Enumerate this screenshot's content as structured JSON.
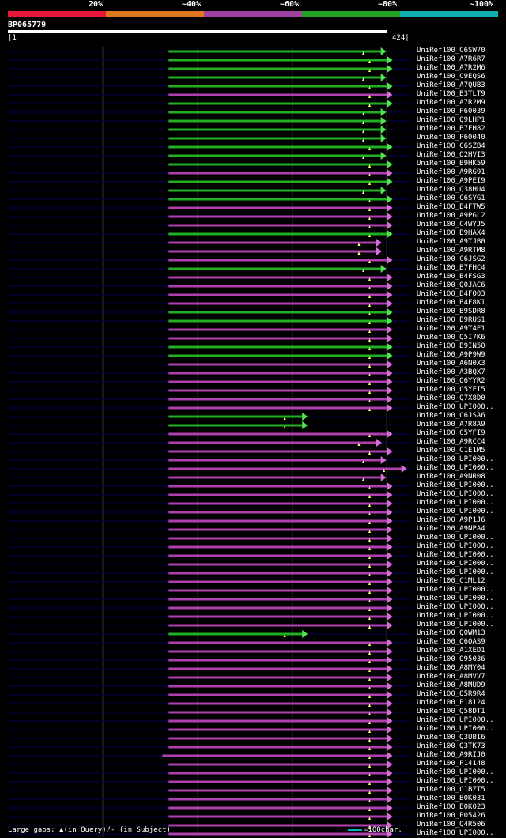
{
  "legend": {
    "colors": [
      "#e8173a",
      "#e07820",
      "#a040a0",
      "#22a022",
      "#10b0b0"
    ],
    "labels": [
      "20%",
      "~40%",
      "~60%",
      "~80%",
      "~100%"
    ]
  },
  "query": {
    "name": "BP065779",
    "start": "1",
    "end": "424"
  },
  "footer": {
    "gaps_text": "Large gaps: ▲(in Query)/- (in Subject)",
    "scale_text": "=100char."
  },
  "colors": {
    "green": "#22b022",
    "purple": "#b040b0",
    "green_head": "#55e055",
    "purple_head": "#d070d0",
    "query": "#ffffff",
    "grid": "#303030",
    "track": "#000055",
    "gap": "#ffff66"
  },
  "hits": [
    {
      "name": "UniRef100_C6SW70",
      "c": "g",
      "s": 180,
      "e": 421
    },
    {
      "name": "UniRef100_A7R6R7",
      "c": "g",
      "s": 180,
      "e": 428
    },
    {
      "name": "UniRef100_A7R2M6",
      "c": "g",
      "s": 180,
      "e": 428
    },
    {
      "name": "UniRef100_C9EQS6",
      "c": "g",
      "s": 180,
      "e": 421
    },
    {
      "name": "UniRef100_A7QUB3",
      "c": "g",
      "s": 180,
      "e": 428
    },
    {
      "name": "UniRef100_B3TLT9",
      "c": "p",
      "s": 180,
      "e": 428
    },
    {
      "name": "UniRef100_A7R2M9",
      "c": "g",
      "s": 180,
      "e": 428
    },
    {
      "name": "UniRef100_P60039",
      "c": "g",
      "s": 180,
      "e": 421
    },
    {
      "name": "UniRef100_Q9LHP1",
      "c": "g",
      "s": 180,
      "e": 421
    },
    {
      "name": "UniRef100_B7FH82",
      "c": "g",
      "s": 180,
      "e": 421
    },
    {
      "name": "UniRef100_P60040",
      "c": "g",
      "s": 180,
      "e": 421
    },
    {
      "name": "UniRef100_C6SZB4",
      "c": "g",
      "s": 180,
      "e": 428
    },
    {
      "name": "UniRef100_Q2HVI3",
      "c": "g",
      "s": 180,
      "e": 421
    },
    {
      "name": "UniRef100_B9HK59",
      "c": "g",
      "s": 180,
      "e": 428
    },
    {
      "name": "UniRef100_A9RG91",
      "c": "p",
      "s": 180,
      "e": 428
    },
    {
      "name": "UniRef100_A9PEI9",
      "c": "g",
      "s": 180,
      "e": 428
    },
    {
      "name": "UniRef100_Q38HU4",
      "c": "g",
      "s": 180,
      "e": 421
    },
    {
      "name": "UniRef100_C6SYG1",
      "c": "g",
      "s": 180,
      "e": 428
    },
    {
      "name": "UniRef100_B4FTW5",
      "c": "p",
      "s": 180,
      "e": 428
    },
    {
      "name": "UniRef100_A9PGL2",
      "c": "p",
      "s": 180,
      "e": 428
    },
    {
      "name": "UniRef100_C4WYJ5",
      "c": "p",
      "s": 180,
      "e": 428
    },
    {
      "name": "UniRef100_B9HAX4",
      "c": "g",
      "s": 180,
      "e": 428
    },
    {
      "name": "UniRef100_A9TJB0",
      "c": "p",
      "s": 180,
      "e": 416
    },
    {
      "name": "UniRef100_A9RTM8",
      "c": "p",
      "s": 180,
      "e": 416
    },
    {
      "name": "UniRef100_C6JSG2",
      "c": "p",
      "s": 180,
      "e": 428
    },
    {
      "name": "UniRef100_B7FHC4",
      "c": "g",
      "s": 180,
      "e": 421
    },
    {
      "name": "UniRef100_B4FSG3",
      "c": "p",
      "s": 180,
      "e": 428
    },
    {
      "name": "UniRef100_Q0JAC6",
      "c": "p",
      "s": 180,
      "e": 428
    },
    {
      "name": "UniRef100_B4FQ03",
      "c": "p",
      "s": 180,
      "e": 428
    },
    {
      "name": "UniRef100_B4F8K1",
      "c": "p",
      "s": 180,
      "e": 428
    },
    {
      "name": "UniRef100_B9SDR8",
      "c": "g",
      "s": 180,
      "e": 428
    },
    {
      "name": "UniRef100_B9RUS1",
      "c": "g",
      "s": 180,
      "e": 428
    },
    {
      "name": "UniRef100_A9T4E1",
      "c": "p",
      "s": 180,
      "e": 428
    },
    {
      "name": "UniRef100_Q5I7K6",
      "c": "p",
      "s": 180,
      "e": 428
    },
    {
      "name": "UniRef100_B9IN50",
      "c": "g",
      "s": 180,
      "e": 428
    },
    {
      "name": "UniRef100_A9P9W9",
      "c": "g",
      "s": 180,
      "e": 428
    },
    {
      "name": "UniRef100_A6N0X3",
      "c": "p",
      "s": 180,
      "e": 428
    },
    {
      "name": "UniRef100_A3BQX7",
      "c": "p",
      "s": 180,
      "e": 428
    },
    {
      "name": "UniRef100_Q6YYR2",
      "c": "p",
      "s": 180,
      "e": 428
    },
    {
      "name": "UniRef100_C5YFI5",
      "c": "p",
      "s": 180,
      "e": 428
    },
    {
      "name": "UniRef100_Q7X8D0",
      "c": "p",
      "s": 180,
      "e": 428
    },
    {
      "name": "UniRef100_UPI000..",
      "c": "p",
      "s": 180,
      "e": 428
    },
    {
      "name": "UniRef100_C6JSA6",
      "c": "g",
      "s": 180,
      "e": 333
    },
    {
      "name": "UniRef100_A7R8A9",
      "c": "g",
      "s": 180,
      "e": 333
    },
    {
      "name": "UniRef100_C5YFI9",
      "c": "p",
      "s": 180,
      "e": 428
    },
    {
      "name": "UniRef100_A9RCC4",
      "c": "p",
      "s": 180,
      "e": 416
    },
    {
      "name": "UniRef100_C1E1M5",
      "c": "p",
      "s": 180,
      "e": 428
    },
    {
      "name": "UniRef100_UPI000..",
      "c": "p",
      "s": 180,
      "e": 421
    },
    {
      "name": "UniRef100_UPI000..",
      "c": "p",
      "s": 180,
      "e": 444
    },
    {
      "name": "UniRef100_A9NR08",
      "c": "p",
      "s": 180,
      "e": 421
    },
    {
      "name": "UniRef100_UPI000..",
      "c": "p",
      "s": 180,
      "e": 428
    },
    {
      "name": "UniRef100_UPI000..",
      "c": "p",
      "s": 180,
      "e": 428
    },
    {
      "name": "UniRef100_UPI000..",
      "c": "p",
      "s": 180,
      "e": 428
    },
    {
      "name": "UniRef100_UPI000..",
      "c": "p",
      "s": 180,
      "e": 428
    },
    {
      "name": "UniRef100_A9P1J6",
      "c": "p",
      "s": 180,
      "e": 428
    },
    {
      "name": "UniRef100_A9NPA4",
      "c": "p",
      "s": 180,
      "e": 428
    },
    {
      "name": "UniRef100_UPI000..",
      "c": "p",
      "s": 180,
      "e": 428
    },
    {
      "name": "UniRef100_UPI000..",
      "c": "p",
      "s": 180,
      "e": 428
    },
    {
      "name": "UniRef100_UPI000..",
      "c": "p",
      "s": 180,
      "e": 428
    },
    {
      "name": "UniRef100_UPI000..",
      "c": "p",
      "s": 180,
      "e": 428
    },
    {
      "name": "UniRef100_UPI000..",
      "c": "p",
      "s": 180,
      "e": 428
    },
    {
      "name": "UniRef100_C1ML12",
      "c": "p",
      "s": 180,
      "e": 428
    },
    {
      "name": "UniRef100_UPI000..",
      "c": "p",
      "s": 180,
      "e": 428
    },
    {
      "name": "UniRef100_UPI000..",
      "c": "p",
      "s": 180,
      "e": 428
    },
    {
      "name": "UniRef100_UPI000..",
      "c": "p",
      "s": 180,
      "e": 428
    },
    {
      "name": "UniRef100_UPI000..",
      "c": "p",
      "s": 180,
      "e": 428
    },
    {
      "name": "UniRef100_UPI000..",
      "c": "p",
      "s": 180,
      "e": 428
    },
    {
      "name": "UniRef100_Q0WM13",
      "c": "g",
      "s": 180,
      "e": 333
    },
    {
      "name": "UniRef100_Q6QAS9",
      "c": "p",
      "s": 180,
      "e": 428
    },
    {
      "name": "UniRef100_A1XED1",
      "c": "p",
      "s": 180,
      "e": 428
    },
    {
      "name": "UniRef100_O95036",
      "c": "p",
      "s": 180,
      "e": 428
    },
    {
      "name": "UniRef100_A8MY04",
      "c": "p",
      "s": 180,
      "e": 428
    },
    {
      "name": "UniRef100_A8MVV7",
      "c": "p",
      "s": 180,
      "e": 428
    },
    {
      "name": "UniRef100_A8MUD9",
      "c": "p",
      "s": 180,
      "e": 428
    },
    {
      "name": "UniRef100_Q5R9R4",
      "c": "p",
      "s": 180,
      "e": 428
    },
    {
      "name": "UniRef100_P18124",
      "c": "p",
      "s": 180,
      "e": 428
    },
    {
      "name": "UniRef100_Q58DT1",
      "c": "p",
      "s": 180,
      "e": 428
    },
    {
      "name": "UniRef100_UPI000..",
      "c": "p",
      "s": 180,
      "e": 428
    },
    {
      "name": "UniRef100_UPI000..",
      "c": "p",
      "s": 180,
      "e": 428
    },
    {
      "name": "UniRef100_Q3UBI6",
      "c": "p",
      "s": 180,
      "e": 428
    },
    {
      "name": "UniRef100_Q3TK73",
      "c": "p",
      "s": 180,
      "e": 428
    },
    {
      "name": "UniRef100_A9RIJ0",
      "c": "p",
      "s": 173,
      "e": 428
    },
    {
      "name": "UniRef100_P14148",
      "c": "p",
      "s": 180,
      "e": 428
    },
    {
      "name": "UniRef100_UPI000..",
      "c": "p",
      "s": 180,
      "e": 428
    },
    {
      "name": "UniRef100_UPI000..",
      "c": "p",
      "s": 180,
      "e": 428
    },
    {
      "name": "UniRef100_C1BZT5",
      "c": "p",
      "s": 180,
      "e": 428
    },
    {
      "name": "UniRef100_B0K031",
      "c": "p",
      "s": 180,
      "e": 428
    },
    {
      "name": "UniRef100_B0K023",
      "c": "p",
      "s": 180,
      "e": 428
    },
    {
      "name": "UniRef100_P05426",
      "c": "p",
      "s": 180,
      "e": 428
    },
    {
      "name": "UniRef100_Q4R506",
      "c": "p",
      "s": 180,
      "e": 428
    },
    {
      "name": "UniRef100_UPI000..",
      "c": "p",
      "s": 180,
      "e": 428
    }
  ]
}
